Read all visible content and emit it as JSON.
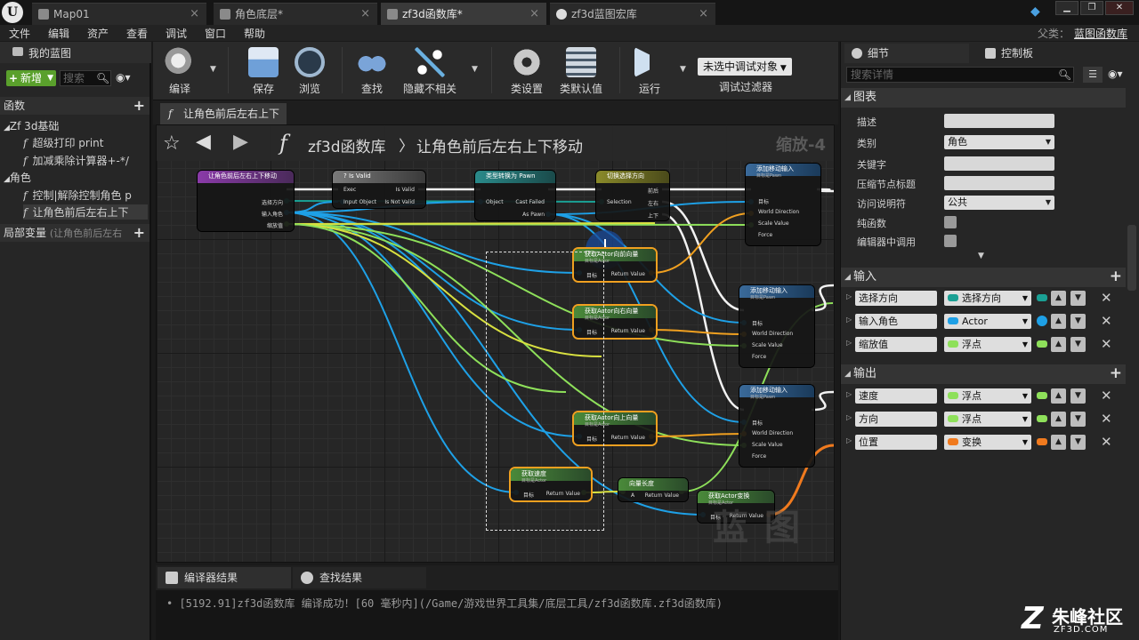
{
  "app": {
    "logo_letter": "U",
    "tabs": [
      {
        "label": "Map01",
        "icon": "level-icon"
      },
      {
        "label": "角色底层*",
        "icon": "blueprint-icon"
      },
      {
        "label": "zf3d函数库*",
        "icon": "function-library-icon"
      },
      {
        "label": "zf3d蓝图宏库",
        "icon": "macro-library-icon"
      }
    ],
    "parent_label": "父类：",
    "parent_value": "蓝图函数库"
  },
  "menu": [
    "文件",
    "编辑",
    "资产",
    "查看",
    "调试",
    "窗口",
    "帮助"
  ],
  "left_panel": {
    "title": "我的蓝图",
    "add_new": "新增",
    "search_placeholder": "搜索",
    "functions_header": "函数",
    "category_1": "Zf 3d基础",
    "functions_cat1": [
      "超级打印 print",
      "加减乘除计算器+-*/"
    ],
    "category_2": "角色",
    "functions_cat2": [
      "控制|解除控制角色 p",
      "让角色前后左右上下"
    ],
    "local_vars_header": "局部变量",
    "local_vars_hint": "(让角色前后左右"
  },
  "toolbar": {
    "buttons": [
      {
        "label": "编译",
        "icon": "compile-icon",
        "color": "#d9d9d9"
      },
      {
        "label": "保存",
        "icon": "save-icon",
        "color": "#6fa0d8"
      },
      {
        "label": "浏览",
        "icon": "browse-icon",
        "color": "#9fb8d0"
      },
      {
        "label": "查找",
        "icon": "find-icon",
        "color": "#7aa4d8"
      },
      {
        "label": "隐藏不相关",
        "icon": "hide-unrelated-icon",
        "color": "#6ab0e0"
      },
      {
        "label": "类设置",
        "icon": "class-settings-icon",
        "color": "#c8c8c8"
      },
      {
        "label": "类默认值",
        "icon": "class-defaults-icon",
        "color": "#d0d8e0"
      },
      {
        "label": "运行",
        "icon": "play-icon",
        "color": "#cfe0f0"
      }
    ],
    "debug_select": "未选中调试对象",
    "debug_filter_label": "调试过滤器"
  },
  "graph": {
    "tab_label": "让角色前后左右上下",
    "breadcrumb_lib": "zf3d函数库",
    "breadcrumb_sep": "〉",
    "breadcrumb_func": "让角色前后左右上下移动",
    "zoom": "缩放-4",
    "watermark": "蓝 图",
    "nodes": [
      {
        "id": "entry",
        "title": "让角色前后左右上下移动",
        "sub": "",
        "pins": [
          "选择方向",
          "输入角色",
          "缩放值"
        ]
      },
      {
        "id": "isvalid",
        "title": "? Is Valid",
        "sub": "",
        "pins": [
          "Exec",
          "Input Object",
          "Is Valid",
          "Is Not Valid"
        ]
      },
      {
        "id": "cast",
        "title": "类型转换为 Pawn",
        "sub": "",
        "pins": [
          "Object",
          "Cast Failed",
          "As Pawn"
        ]
      },
      {
        "id": "switch",
        "title": "切换选择方向",
        "sub": "",
        "pins": [
          "Selection",
          "前后",
          "左右",
          "上下"
        ]
      },
      {
        "id": "add1",
        "title": "添加移动输入",
        "sub": "目标是Pawn",
        "pins": [
          "目标",
          "World Direction",
          "Scale Value",
          "Force"
        ]
      },
      {
        "id": "fwd",
        "title": "获取Actor向前向量",
        "sub": "目标是Actor",
        "pins": [
          "目标",
          "Return Value"
        ]
      },
      {
        "id": "right",
        "title": "获取Actor向右向量",
        "sub": "目标是Actor",
        "pins": [
          "目标",
          "Return Value"
        ]
      },
      {
        "id": "add2",
        "title": "添加移动输入",
        "sub": "目标是Pawn",
        "pins": [
          "目标",
          "World Direction",
          "Scale Value",
          "Force"
        ]
      },
      {
        "id": "up",
        "title": "获取Actor向上向量",
        "sub": "目标是Actor",
        "pins": [
          "目标",
          "Return Value"
        ]
      },
      {
        "id": "add3",
        "title": "添加移动输入",
        "sub": "目标是Pawn",
        "pins": [
          "目标",
          "World Direction",
          "Scale Value",
          "Force"
        ]
      },
      {
        "id": "vel",
        "title": "获取速度",
        "sub": "目标是Actor",
        "pins": [
          "目标",
          "Return Value"
        ]
      },
      {
        "id": "vlen",
        "title": "向量长度",
        "sub": "",
        "pins": [
          "A",
          "Return Value"
        ]
      },
      {
        "id": "xform",
        "title": "获取Actor变换",
        "sub": "目标是Actor",
        "pins": [
          "目标",
          "Return Value"
        ]
      }
    ]
  },
  "bottom": {
    "tabs": [
      "编译器结果",
      "查找结果"
    ],
    "log": "[5192.91]zf3d函数库 编译成功！[60 毫秒内](/Game/游戏世界工具集/底层工具/zf3d函数库.zf3d函数库)"
  },
  "right_panel": {
    "tabs": [
      "细节",
      "控制板"
    ],
    "search_placeholder": "搜索详情",
    "graph_section": "图表",
    "props": [
      {
        "label": "描述",
        "kind": "text",
        "value": ""
      },
      {
        "label": "类别",
        "kind": "dropdown",
        "value": "角色"
      },
      {
        "label": "关键字",
        "kind": "text",
        "value": ""
      },
      {
        "label": "压缩节点标题",
        "kind": "text",
        "value": ""
      },
      {
        "label": "访问说明符",
        "kind": "dropdown",
        "value": "公共"
      },
      {
        "label": "纯函数",
        "kind": "check",
        "value": ""
      },
      {
        "label": "编辑器中调用",
        "kind": "check",
        "value": ""
      }
    ],
    "inputs_section": "输入",
    "inputs": [
      {
        "name": "选择方向",
        "type": "选择方向",
        "color": "#1aa094"
      },
      {
        "name": "输入角色",
        "type": "Actor",
        "color": "#1ea0e6"
      },
      {
        "name": "缩放值",
        "type": "浮点",
        "color": "#8ee05a"
      }
    ],
    "outputs_section": "输出",
    "outputs": [
      {
        "name": "速度",
        "type": "浮点",
        "color": "#8ee05a"
      },
      {
        "name": "方向",
        "type": "浮点",
        "color": "#8ee05a"
      },
      {
        "name": "位置",
        "type": "变换",
        "color": "#f07a1e"
      }
    ]
  },
  "site_logo": {
    "mark": "Z",
    "name": "朱峰社区",
    "url": "ZF3D.COM"
  }
}
